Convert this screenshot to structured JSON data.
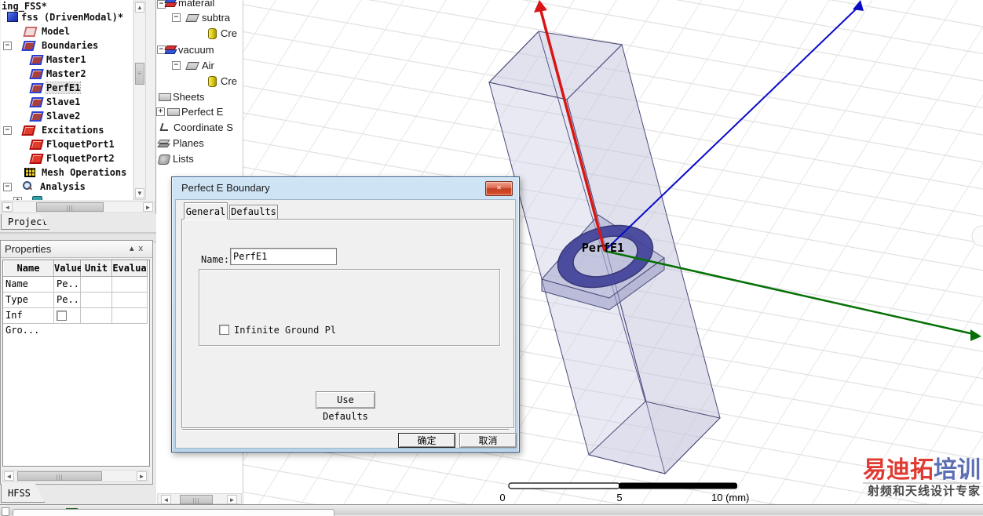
{
  "project_panel": {
    "header": "ing_FSS*",
    "tab": "Project",
    "items": [
      {
        "label": "fss (DrivenModal)*"
      },
      {
        "label": "Model"
      },
      {
        "label": "Boundaries"
      },
      {
        "label": "Master1"
      },
      {
        "label": "Master2"
      },
      {
        "label": "PerfE1"
      },
      {
        "label": "Slave1"
      },
      {
        "label": "Slave2"
      },
      {
        "label": "Excitations"
      },
      {
        "label": "FloquetPort1"
      },
      {
        "label": "FloquetPort2"
      },
      {
        "label": "Mesh Operations"
      },
      {
        "label": "Analysis"
      }
    ]
  },
  "modeler_panel": {
    "items": [
      "materail",
      "subtra",
      "Cre",
      "vacuum",
      "Air",
      "Cre",
      "Sheets",
      "Perfect E",
      "Coordinate S",
      "Planes",
      "Lists"
    ]
  },
  "properties_panel": {
    "title": "Properties",
    "collapse_glyph": "▴",
    "close_glyph": "x",
    "columns": [
      "Name",
      "Value",
      "Unit",
      "Evalua"
    ],
    "rows": [
      {
        "name": "Name",
        "value": "Pe..."
      },
      {
        "name": "Type",
        "value": "Pe..."
      },
      {
        "name": "Inf Gro...",
        "value": ""
      }
    ],
    "tab": "HFSS"
  },
  "dialog": {
    "title": "Perfect E Boundary",
    "close_glyph": "✕",
    "tabs": [
      "General",
      "Defaults"
    ],
    "name_label": "Name:",
    "name_value": "PerfE1",
    "infinite_ground_label": "Infinite Ground Pl",
    "use_defaults_label": "Use Defaults",
    "ok_label": "确定",
    "cancel_label": "取消"
  },
  "viewport": {
    "object_label": "PerfE1",
    "scale_bar": {
      "t0": "0",
      "t5": "5",
      "t10": "10 (mm)"
    },
    "axes": {
      "x": "#d81616",
      "y": "#0a0ac8",
      "z": "#067006"
    },
    "model_edge_color": "#4a4a7a",
    "ring_color": "#42429a"
  },
  "watermark": {
    "brand_red": "易迪拓",
    "brand_blue": "培训",
    "tagline": "射频和天线设计专家"
  },
  "scrollbar": {
    "left": "◄",
    "right": "►",
    "up": "▲",
    "down": "▼",
    "grip_h": "|||",
    "grip_v": "≡"
  }
}
